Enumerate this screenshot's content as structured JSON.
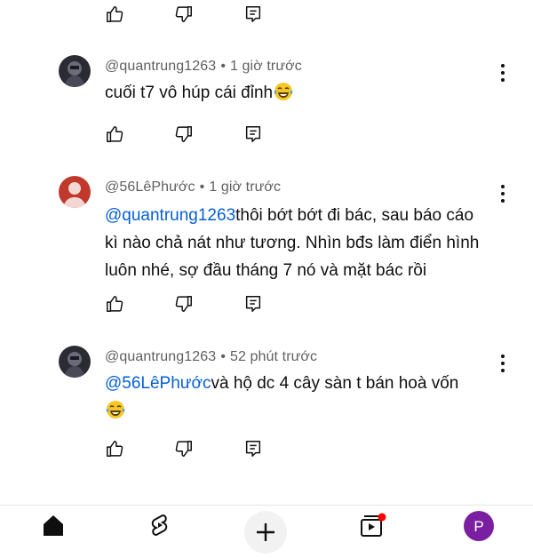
{
  "comments": [
    {
      "author": "@quantrung1263",
      "time": "1 giờ trước",
      "text": "cuối t7 vô húp cái đỉnh",
      "emoji": "laughing-tears"
    },
    {
      "author": "@56LêPhước",
      "time": "1 giờ trước",
      "mention": "@quantrung1263",
      "lines": [
        "thôi bớt bớt đi bác, sau báo cáo",
        "kì nào chả nát như tương. Nhìn bđs làm điển hình",
        "luôn nhé, sợ đầu tháng 7 nó và mặt bác rồi"
      ]
    },
    {
      "author": "@quantrung1263",
      "time": "52 phút trước",
      "mention": "@56LêPhước",
      "text": "và hộ dc 4 cây sàn t bán hoà vốn",
      "emoji": "laughing-tears"
    }
  ],
  "meta_separator": "•",
  "profile_initial": "P",
  "colors": {
    "mention": "#065fd4",
    "meta": "#606060",
    "profile": "#7b1fa2",
    "avatar2": "#c0392b",
    "notification": "#ff0000"
  }
}
